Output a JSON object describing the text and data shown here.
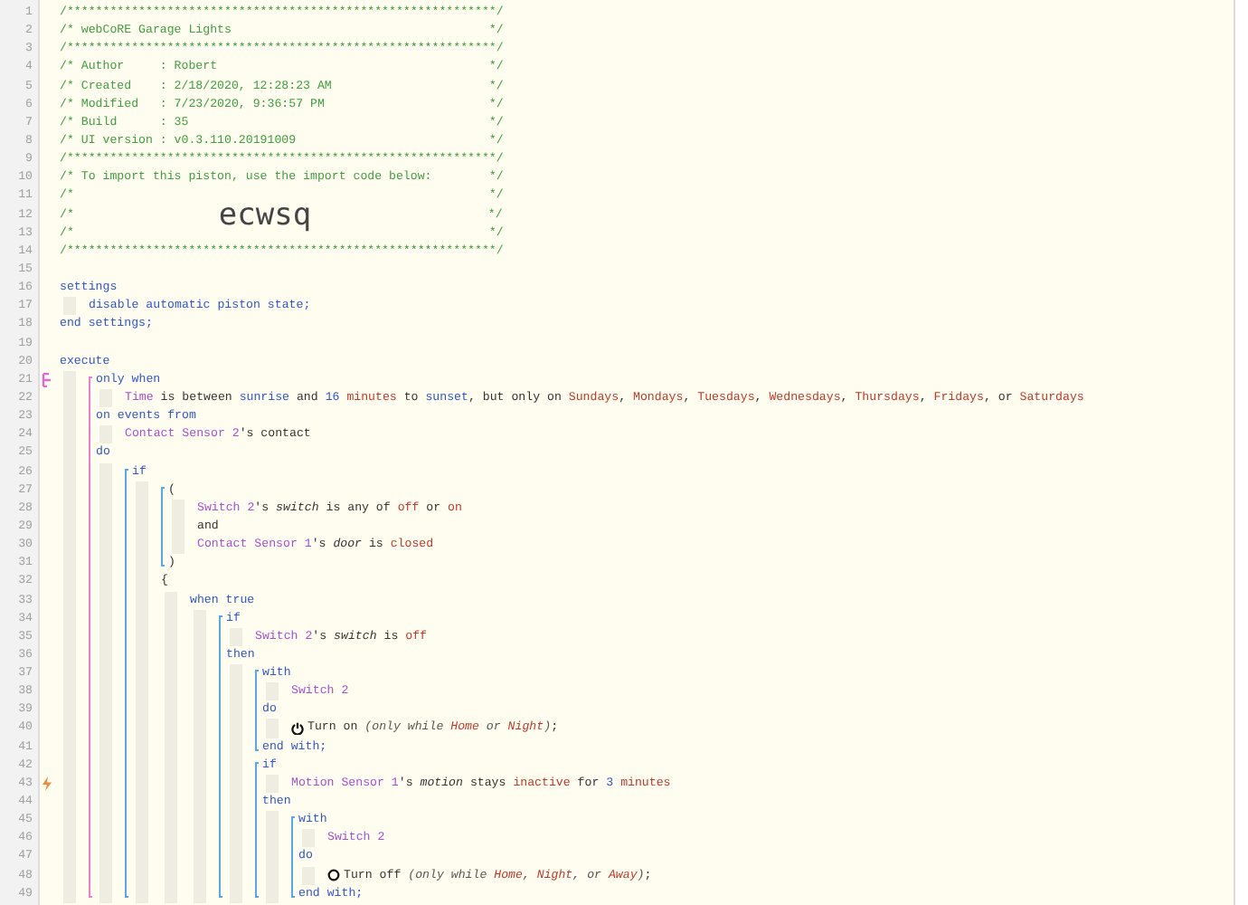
{
  "listing": [
    {
      "no": "1",
      "segments": [
        {
          "kind": "comment",
          "text": "/************************************************************/"
        }
      ]
    },
    {
      "no": "2",
      "segments": [
        {
          "kind": "comment",
          "text": "/* webCoRE Garage Lights                                    */"
        }
      ]
    },
    {
      "no": "3",
      "segments": [
        {
          "kind": "comment",
          "text": "/************************************************************/"
        }
      ]
    },
    {
      "no": "4",
      "segments": [
        {
          "kind": "comment",
          "text": "/* Author     : Robert                                      */"
        }
      ]
    },
    {
      "no": "5",
      "segments": [
        {
          "kind": "comment",
          "text": "/* Created    : 2/18/2020, 12:28:23 AM                      */"
        }
      ]
    },
    {
      "no": "6",
      "segments": [
        {
          "kind": "comment",
          "text": "/* Modified   : 7/23/2020, 9:36:57 PM                       */"
        }
      ]
    },
    {
      "no": "7",
      "segments": [
        {
          "kind": "comment",
          "text": "/* Build      : 35                                          */"
        }
      ]
    },
    {
      "no": "8",
      "segments": [
        {
          "kind": "comment",
          "text": "/* UI version : v0.3.110.20191009                           */"
        }
      ]
    },
    {
      "no": "9",
      "segments": [
        {
          "kind": "comment",
          "text": "/************************************************************/"
        }
      ]
    },
    {
      "no": "10",
      "segments": [
        {
          "kind": "comment",
          "text": "/* To import this piston, use the import code below:        */"
        }
      ]
    },
    {
      "no": "11",
      "segments": [
        {
          "kind": "comment",
          "text": "/*                                                          */"
        }
      ]
    },
    {
      "no": "12",
      "segments": [
        {
          "kind": "comment",
          "text": "/*"
        },
        {
          "kind": "code",
          "text": "ecwsq"
        },
        {
          "kind": "comment",
          "text": "*/"
        }
      ]
    },
    {
      "no": "13",
      "segments": [
        {
          "kind": "comment",
          "text": "/*                                                          */"
        }
      ]
    },
    {
      "no": "14",
      "segments": [
        {
          "kind": "comment",
          "text": "/************************************************************/"
        }
      ]
    },
    {
      "no": "15"
    },
    {
      "no": "16",
      "segments": [
        {
          "kind": "kw",
          "text": "settings"
        }
      ]
    },
    {
      "children": [
        {
          "no": "17",
          "segments": [
            {
              "kind": "kw",
              "text": "disable automatic piston state;"
            }
          ]
        }
      ]
    },
    {
      "no": "18",
      "segments": [
        {
          "kind": "kw",
          "text": "end settings;"
        }
      ]
    },
    {
      "no": "19"
    },
    {
      "no": "20",
      "segments": [
        {
          "kind": "kw",
          "text": "execute"
        }
      ]
    },
    {
      "children": [
        {
          "color": "#e67fd6",
          "children": [
            {
              "no": "21",
              "kind": "restriction",
              "segments": [
                {
                  "kind": "kw",
                  "text": "only when"
                }
              ]
            },
            {
              "children": [
                {
                  "no": "22",
                  "segments": [
                    {
                      "kind": "dev",
                      "text": "Time"
                    },
                    {
                      "kind": "plain",
                      "text": " is between "
                    },
                    {
                      "kind": "kw",
                      "text": "sunrise"
                    },
                    {
                      "kind": "plain",
                      "text": " and "
                    },
                    {
                      "kind": "num",
                      "text": "16"
                    },
                    {
                      "kind": "val",
                      "text": " minutes"
                    },
                    {
                      "kind": "plain",
                      "text": " to "
                    },
                    {
                      "kind": "kw",
                      "text": "sunset"
                    },
                    {
                      "kind": "plain",
                      "text": ", but only on "
                    },
                    {
                      "kind": "val",
                      "text": "Sundays"
                    },
                    {
                      "kind": "plain",
                      "text": ", "
                    },
                    {
                      "kind": "val",
                      "text": "Mondays"
                    },
                    {
                      "kind": "plain",
                      "text": ", "
                    },
                    {
                      "kind": "val",
                      "text": "Tuesdays"
                    },
                    {
                      "kind": "plain",
                      "text": ", "
                    },
                    {
                      "kind": "val",
                      "text": "Wednesdays"
                    },
                    {
                      "kind": "plain",
                      "text": ", "
                    },
                    {
                      "kind": "val",
                      "text": "Thursdays"
                    },
                    {
                      "kind": "plain",
                      "text": ", "
                    },
                    {
                      "kind": "val",
                      "text": "Fridays"
                    },
                    {
                      "kind": "plain",
                      "text": ", or "
                    },
                    {
                      "kind": "val",
                      "text": "Saturdays"
                    }
                  ]
                }
              ]
            },
            {
              "no": "23",
              "segments": [
                {
                  "kind": "kw",
                  "text": "on events from"
                }
              ]
            },
            {
              "children": [
                {
                  "no": "24",
                  "segments": [
                    {
                      "kind": "dev",
                      "text": "Contact Sensor 2"
                    },
                    {
                      "kind": "plain",
                      "text": "'s contact"
                    }
                  ]
                }
              ]
            },
            {
              "no": "25",
              "segments": [
                {
                  "kind": "kw",
                  "text": "do"
                }
              ]
            },
            {
              "children": [
                {
                  "color": "#5aa9e6",
                  "children": [
                    {
                      "no": "26",
                      "segments": [
                        {
                          "kind": "kw",
                          "text": "if"
                        }
                      ]
                    },
                    {
                      "children": [
                        {
                          "color": "#5aa9e6",
                          "children": [
                            {
                              "no": "27",
                              "segments": [
                                {
                                  "kind": "plain",
                                  "text": "("
                                }
                              ]
                            },
                            {
                              "children": [
                                {
                                  "no": "28",
                                  "segments": [
                                    {
                                      "kind": "dev",
                                      "text": "Switch 2"
                                    },
                                    {
                                      "kind": "plain",
                                      "text": "'s "
                                    },
                                    {
                                      "kind": "attr",
                                      "text": "switch"
                                    },
                                    {
                                      "kind": "plain",
                                      "text": " is any of "
                                    },
                                    {
                                      "kind": "val",
                                      "text": "off"
                                    },
                                    {
                                      "kind": "plain",
                                      "text": " or "
                                    },
                                    {
                                      "kind": "val",
                                      "text": "on"
                                    }
                                  ]
                                },
                                {
                                  "no": "29",
                                  "segments": [
                                    {
                                      "kind": "plain",
                                      "text": "and"
                                    }
                                  ]
                                },
                                {
                                  "no": "30",
                                  "segments": [
                                    {
                                      "kind": "dev",
                                      "text": "Contact Sensor 1"
                                    },
                                    {
                                      "kind": "plain",
                                      "text": "'s "
                                    },
                                    {
                                      "kind": "attr",
                                      "text": "door"
                                    },
                                    {
                                      "kind": "plain",
                                      "text": " is "
                                    },
                                    {
                                      "kind": "val",
                                      "text": "closed"
                                    }
                                  ]
                                }
                              ]
                            },
                            {
                              "no": "31",
                              "segments": [
                                {
                                  "kind": "plain",
                                  "text": ")"
                                }
                              ]
                            }
                          ]
                        },
                        {
                          "no": "32",
                          "segments": [
                            {
                              "kind": "plain",
                              "text": "{"
                            }
                          ]
                        },
                        {
                          "children": [
                            {
                              "no": "33",
                              "segments": [
                                {
                                  "kind": "kw",
                                  "text": "when true"
                                }
                              ]
                            },
                            {
                              "children": [
                                {
                                  "color": "#5aa9e6",
                                  "children": [
                                    {
                                      "no": "34",
                                      "segments": [
                                        {
                                          "kind": "kw",
                                          "text": "if"
                                        }
                                      ]
                                    },
                                    {
                                      "children": [
                                        {
                                          "no": "35",
                                          "segments": [
                                            {
                                              "kind": "dev",
                                              "text": "Switch 2"
                                            },
                                            {
                                              "kind": "plain",
                                              "text": "'s "
                                            },
                                            {
                                              "kind": "attr",
                                              "text": "switch"
                                            },
                                            {
                                              "kind": "plain",
                                              "text": " is "
                                            },
                                            {
                                              "kind": "val",
                                              "text": "off"
                                            }
                                          ]
                                        }
                                      ]
                                    },
                                    {
                                      "no": "36",
                                      "segments": [
                                        {
                                          "kind": "kw",
                                          "text": "then"
                                        }
                                      ]
                                    },
                                    {
                                      "children": [
                                        {
                                          "color": "#5aa9e6",
                                          "children": [
                                            {
                                              "no": "37",
                                              "segments": [
                                                {
                                                  "kind": "kw",
                                                  "text": "with"
                                                }
                                              ]
                                            },
                                            {
                                              "children": [
                                                {
                                                  "no": "38",
                                                  "segments": [
                                                    {
                                                      "kind": "dev",
                                                      "text": "Switch 2"
                                                    }
                                                  ]
                                                }
                                              ]
                                            },
                                            {
                                              "no": "39",
                                              "segments": [
                                                {
                                                  "kind": "kw",
                                                  "text": "do"
                                                }
                                              ]
                                            },
                                            {
                                              "children": [
                                                {
                                                  "no": "40",
                                                  "kind": "on_command",
                                                  "segments": [
                                                    {
                                                      "kind": "plain",
                                                      "text": "Turn on "
                                                    },
                                                    {
                                                      "kind": "ital",
                                                      "text": "(only while "
                                                    },
                                                    {
                                                      "kind": "ival",
                                                      "text": "Home"
                                                    },
                                                    {
                                                      "kind": "ital",
                                                      "text": " or "
                                                    },
                                                    {
                                                      "kind": "ival",
                                                      "text": "Night"
                                                    },
                                                    {
                                                      "kind": "ital",
                                                      "text": ")"
                                                    },
                                                    {
                                                      "kind": "plain",
                                                      "text": ";"
                                                    }
                                                  ]
                                                }
                                              ]
                                            },
                                            {
                                              "no": "41",
                                              "segments": [
                                                {
                                                  "kind": "kw",
                                                  "text": "end with;"
                                                }
                                              ]
                                            }
                                          ]
                                        },
                                        {
                                          "color": "#5aa9e6",
                                          "children": [
                                            {
                                              "no": "42",
                                              "segments": [
                                                {
                                                  "kind": "kw",
                                                  "text": "if"
                                                }
                                              ]
                                            },
                                            {
                                              "children": [
                                                {
                                                  "no": "43",
                                                  "kind": "trigger",
                                                  "segments": [
                                                    {
                                                      "kind": "dev",
                                                      "text": "Motion Sensor 1"
                                                    },
                                                    {
                                                      "kind": "plain",
                                                      "text": "'s "
                                                    },
                                                    {
                                                      "kind": "attr",
                                                      "text": "motion"
                                                    },
                                                    {
                                                      "kind": "plain",
                                                      "text": " stays "
                                                    },
                                                    {
                                                      "kind": "val",
                                                      "text": "inactive"
                                                    },
                                                    {
                                                      "kind": "plain",
                                                      "text": " for "
                                                    },
                                                    {
                                                      "kind": "num",
                                                      "text": "3"
                                                    },
                                                    {
                                                      "kind": "val",
                                                      "text": " minutes"
                                                    }
                                                  ]
                                                }
                                              ]
                                            },
                                            {
                                              "no": "44",
                                              "segments": [
                                                {
                                                  "kind": "kw",
                                                  "text": "then"
                                                }
                                              ]
                                            },
                                            {
                                              "children": [
                                                {
                                                  "color": "#5aa9e6",
                                                  "children": [
                                                    {
                                                      "no": "45",
                                                      "segments": [
                                                        {
                                                          "kind": "kw",
                                                          "text": "with"
                                                        }
                                                      ]
                                                    },
                                                    {
                                                      "children": [
                                                        {
                                                          "no": "46",
                                                          "segments": [
                                                            {
                                                              "kind": "dev",
                                                              "text": "Switch 2"
                                                            }
                                                          ]
                                                        }
                                                      ]
                                                    },
                                                    {
                                                      "no": "47",
                                                      "segments": [
                                                        {
                                                          "kind": "kw",
                                                          "text": "do"
                                                        }
                                                      ]
                                                    },
                                                    {
                                                      "children": [
                                                        {
                                                          "no": "48",
                                                          "kind": "off_command",
                                                          "segments": [
                                                            {
                                                              "kind": "plain",
                                                              "text": "Turn off "
                                                            },
                                                            {
                                                              "kind": "ital",
                                                              "text": "(only while "
                                                            },
                                                            {
                                                              "kind": "ival",
                                                              "text": "Home"
                                                            },
                                                            {
                                                              "kind": "ital",
                                                              "text": ", "
                                                            },
                                                            {
                                                              "kind": "ival",
                                                              "text": "Night"
                                                            },
                                                            {
                                                              "kind": "ital",
                                                              "text": ", or "
                                                            },
                                                            {
                                                              "kind": "ival",
                                                              "text": "Away"
                                                            },
                                                            {
                                                              "kind": "ital",
                                                              "text": ")"
                                                            },
                                                            {
                                                              "kind": "plain",
                                                              "text": ";"
                                                            }
                                                          ]
                                                        }
                                                      ]
                                                    },
                                                    {
                                                      "no": "49",
                                                      "segments": [
                                                        {
                                                          "kind": "kw",
                                                          "text": "end with;"
                                                        }
                                                      ]
                                                    }
                                                  ]
                                                }
                                              ]
                                            }
                                          ]
                                        }
                                      ]
                                    }
                                  ]
                                }
                              ]
                            }
                          ]
                        }
                      ]
                    }
                  ]
                }
              ]
            }
          ]
        }
      ]
    }
  ]
}
